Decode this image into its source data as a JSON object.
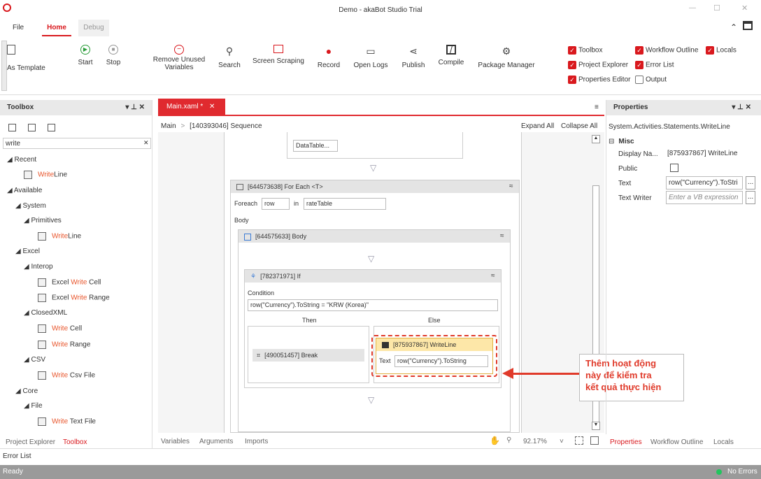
{
  "window": {
    "title": "Demo - akaBot Studio Trial",
    "min": "—",
    "max": "☐",
    "close": "✕"
  },
  "menu": {
    "file": "File",
    "home": "Home",
    "debug": "Debug"
  },
  "ribbon": {
    "template": "As Template",
    "start": "Start",
    "stop": "Stop",
    "remove_unused": "Remove Unused",
    "remove_unused2": "Variables",
    "search": "Search",
    "screen_scraping": "Screen Scraping",
    "record": "Record",
    "open_logs": "Open Logs",
    "publish": "Publish",
    "compile": "Compile",
    "package_manager": "Package Manager",
    "checks": {
      "toolbox": "Toolbox",
      "workflow_outline": "Workflow Outline",
      "locals": "Locals",
      "project_explorer": "Project Explorer",
      "error_list": "Error List",
      "properties_editor": "Properties Editor",
      "output": "Output"
    }
  },
  "toolbox": {
    "title": "Toolbox",
    "pin": "▾ ⊥ ✕",
    "search_value": "write",
    "clear": "✕",
    "recent": "Recent",
    "available": "Available",
    "system": "System",
    "primitives": "Primitives",
    "excel": "Excel",
    "interop": "Interop",
    "closedxml": "ClosedXML",
    "csv": "CSV",
    "core": "Core",
    "file": "File",
    "w": "Write",
    "line": "Line",
    "excel_prefix": "Excel ",
    "cell": " Cell",
    "range": " Range",
    "csv_file": " Csv File",
    "text_file": " Text File"
  },
  "designer": {
    "tab": "Main.xaml *",
    "tab_close": "✕",
    "breadcrumb_main": "Main",
    "breadcrumb_sep": ">",
    "breadcrumb_seq": "[140393046] Sequence",
    "expand_all": "Expand All",
    "collapse_all": "Collapse All",
    "datatable": "DataTable...",
    "foreach_title": "[644573638] For Each <T>",
    "foreach_label": "Foreach",
    "foreach_var": "row",
    "in_label": "in",
    "foreach_in": "rateTable",
    "body_label": "Body",
    "body_title": "[644575633] Body",
    "if_title": "[782371971] If",
    "condition_label": "Condition",
    "condition": "row(\"Currency\").ToString = \"KRW (Korea)\"",
    "then": "Then",
    "else": "Else",
    "break": "[490051457] Break",
    "writeline_title": "[875937867] WriteLine",
    "text_label": "Text",
    "text_value": "row(\"Currency\").ToString",
    "annotation": [
      "Thêm hoạt động",
      "này để kiểm tra",
      "kết quả thực hiện"
    ]
  },
  "designer_footer": {
    "variables": "Variables",
    "arguments": "Arguments",
    "imports": "Imports",
    "zoom": "92.17%",
    "zoom_arrow": "˅"
  },
  "properties": {
    "title": "Properties",
    "pin": "▾ ⊥ ✕",
    "class": "System.Activities.Statements.WriteLine",
    "misc": "Misc",
    "misc_toggle": "⊟",
    "display_name_label": "Display Na...",
    "display_name": "[875937867] WriteLine",
    "public_label": "Public",
    "text_label": "Text",
    "text_value": "row(\"Currency\").ToStri",
    "text_writer_label": "Text Writer",
    "text_writer_placeholder": "Enter a VB expression",
    "more": "..."
  },
  "bottom_tabs": {
    "project_explorer": "Project Explorer",
    "toolbox": "Toolbox",
    "properties": "Properties",
    "workflow_outline": "Workflow Outline",
    "locals": "Locals",
    "error_list": "Error List"
  },
  "status": {
    "ready": "Ready",
    "errors": "No Errors"
  },
  "colors": {
    "accent": "#d9191e",
    "annotation": "#e03a2a"
  }
}
